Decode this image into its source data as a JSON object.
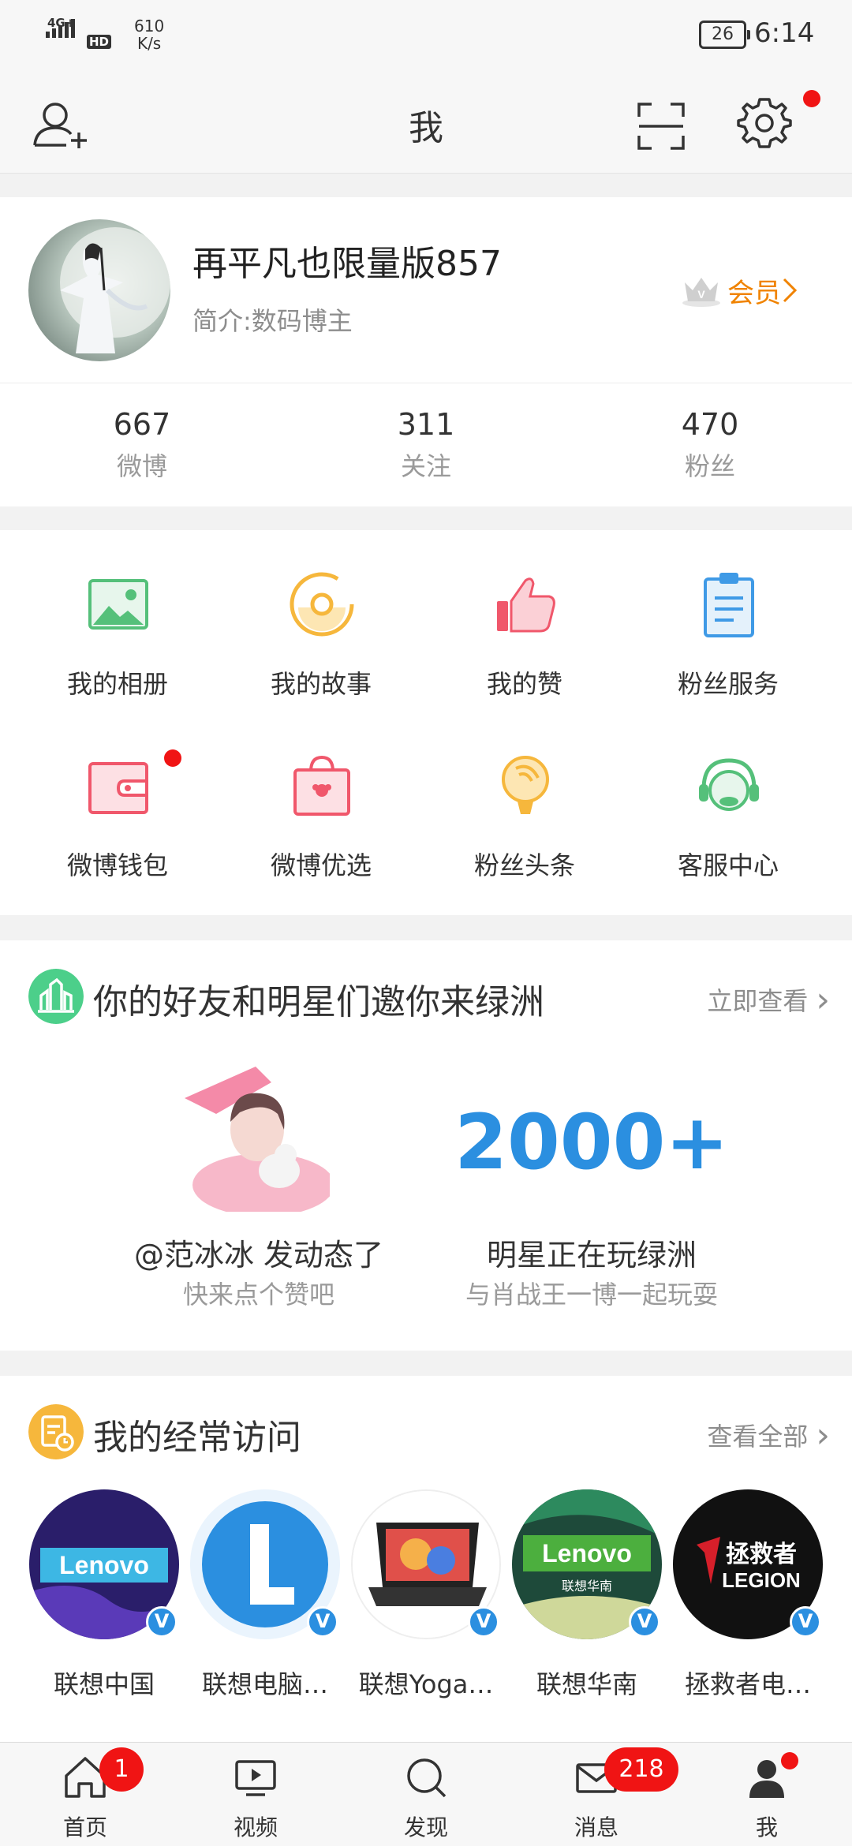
{
  "status_bar": {
    "network": "4G+",
    "hd": "HD",
    "speed": "610\nK/s",
    "battery": "26",
    "time": "6:14"
  },
  "nav": {
    "title": "我",
    "left_icon": "add-friend-icon",
    "scan_icon": "scan-icon",
    "settings_icon": "gear-icon"
  },
  "profile": {
    "username": "再平凡也限量版857",
    "bio": "简介:数码博主",
    "vip_label": "会员"
  },
  "stats": [
    {
      "value": "667",
      "label": "微博"
    },
    {
      "value": "311",
      "label": "关注"
    },
    {
      "value": "470",
      "label": "粉丝"
    }
  ],
  "grid": [
    {
      "label": "我的相册",
      "icon": "album-icon"
    },
    {
      "label": "我的故事",
      "icon": "story-icon"
    },
    {
      "label": "我的赞",
      "icon": "thumbs-up-icon"
    },
    {
      "label": "粉丝服务",
      "icon": "clipboard-icon"
    },
    {
      "label": "微博钱包",
      "icon": "wallet-icon"
    },
    {
      "label": "微博优选",
      "icon": "shopping-bag-icon"
    },
    {
      "label": "粉丝头条",
      "icon": "lightbulb-icon"
    },
    {
      "label": "客服中心",
      "icon": "headset-icon"
    }
  ],
  "oasis": {
    "title": "你的好友和明星们邀你来绿洲",
    "more": "立即查看",
    "left_title": "@范冰冰 发动态了",
    "left_sub": "快来点个赞吧",
    "big_number": "2000+",
    "right_title": "明星正在玩绿洲",
    "right_sub": "与肖战王一博一起玩耍"
  },
  "frequent": {
    "title": "我的经常访问",
    "more": "查看全部",
    "items": [
      {
        "name": "联想中国"
      },
      {
        "name": "联想电脑…"
      },
      {
        "name": "联想Yoga…"
      },
      {
        "name": "联想华南"
      },
      {
        "name": "拯救者电…"
      }
    ],
    "logo_text": {
      "lenovo": "Lenovo",
      "lenovo_south": "联想华南",
      "legion_cn": "拯救者",
      "legion_en": "LEGION"
    },
    "verified_mark": "V"
  },
  "tabs": [
    {
      "label": "首页",
      "icon": "home-icon",
      "badge": "1"
    },
    {
      "label": "视频",
      "icon": "video-icon"
    },
    {
      "label": "发现",
      "icon": "search-icon"
    },
    {
      "label": "消息",
      "icon": "mail-icon",
      "badge": "218"
    },
    {
      "label": "我",
      "icon": "person-icon"
    }
  ],
  "colors": {
    "accent_orange": "#f08300",
    "badge_red": "#f01414",
    "verified_blue": "#2b8fe0"
  }
}
